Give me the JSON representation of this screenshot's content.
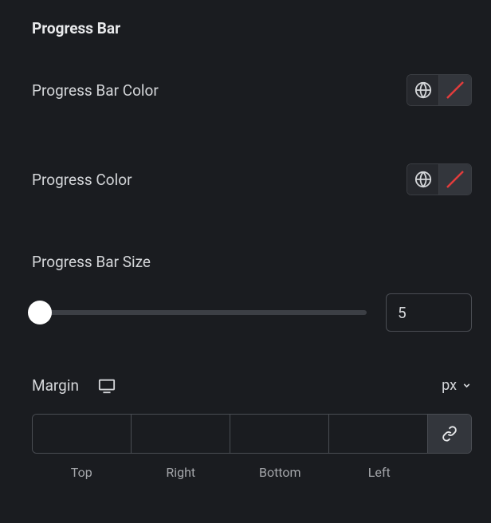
{
  "section": {
    "title": "Progress Bar"
  },
  "controls": {
    "barColor": {
      "label": "Progress Bar Color"
    },
    "progressColor": {
      "label": "Progress Color"
    },
    "barSize": {
      "label": "Progress Bar Size",
      "value": "5"
    }
  },
  "margin": {
    "label": "Margin",
    "unit": "px",
    "sides": {
      "top": {
        "label": "Top",
        "value": ""
      },
      "right": {
        "label": "Right",
        "value": ""
      },
      "bottom": {
        "label": "Bottom",
        "value": ""
      },
      "left": {
        "label": "Left",
        "value": ""
      }
    }
  }
}
